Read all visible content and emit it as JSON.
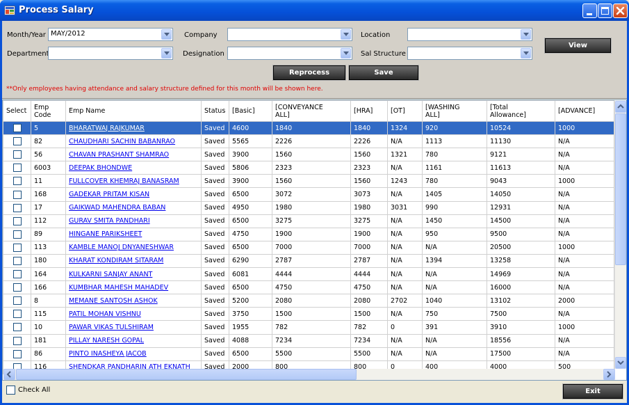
{
  "window": {
    "title": "Process Salary"
  },
  "filters": {
    "month_year": {
      "label": "Month/Year",
      "value": "MAY/2012"
    },
    "company": {
      "label": "Company",
      "value": ""
    },
    "location": {
      "label": "Location",
      "value": ""
    },
    "department": {
      "label": "Department",
      "value": ""
    },
    "designation": {
      "label": "Designation",
      "value": ""
    },
    "sal_structure": {
      "label": "Sal Structure",
      "value": ""
    }
  },
  "buttons": {
    "view": "View",
    "reprocess": "Reprocess",
    "save": "Save",
    "exit": "Exit"
  },
  "note": "**Only employees having attendance and salary structure defined for this month will be shown here.",
  "grid": {
    "columns": [
      "Select",
      "Emp Code",
      "Emp Name",
      "Status",
      "[Basic]",
      "[CONVEYANCE ALL]",
      "[HRA]",
      "[OT]",
      "[WASHING ALL]",
      "[Total Allowance]",
      "[ADVANCE]"
    ],
    "rows": [
      {
        "code": "5",
        "name": "BHARATWAJ RAJKUMAR",
        "status": "Saved",
        "basic": "4600",
        "conv": "1840",
        "hra": "1840",
        "ot": "1324",
        "wash": "920",
        "total": "10524",
        "adv": "1000",
        "selected": true
      },
      {
        "code": "82",
        "name": "CHAUDHARI SACHIN BABANRAO",
        "status": "Saved",
        "basic": "5565",
        "conv": "2226",
        "hra": "2226",
        "ot": "N/A",
        "wash": "1113",
        "total": "11130",
        "adv": "N/A"
      },
      {
        "code": "56",
        "name": "CHAVAN PRASHANT SHAMRAO",
        "status": "Saved",
        "basic": "3900",
        "conv": "1560",
        "hra": "1560",
        "ot": "1321",
        "wash": "780",
        "total": "9121",
        "adv": "N/A"
      },
      {
        "code": "6003",
        "name": "DEEPAK BHONDWE",
        "status": "Saved",
        "basic": "5806",
        "conv": "2323",
        "hra": "2323",
        "ot": "N/A",
        "wash": "1161",
        "total": "11613",
        "adv": "N/A"
      },
      {
        "code": "11",
        "name": "FULLCOVER KHEMRAJ BANASRAM",
        "status": "Saved",
        "basic": "3900",
        "conv": "1560",
        "hra": "1560",
        "ot": "1243",
        "wash": "780",
        "total": "9043",
        "adv": "1000"
      },
      {
        "code": "168",
        "name": "GADEKAR PRITAM KISAN",
        "status": "Saved",
        "basic": "6500",
        "conv": "3072",
        "hra": "3073",
        "ot": "N/A",
        "wash": "1405",
        "total": "14050",
        "adv": "N/A"
      },
      {
        "code": "17",
        "name": "GAIKWAD MAHENDRA BABAN",
        "status": "Saved",
        "basic": "4950",
        "conv": "1980",
        "hra": "1980",
        "ot": "3031",
        "wash": "990",
        "total": "12931",
        "adv": "N/A"
      },
      {
        "code": "112",
        "name": "GURAV SMITA PANDHARI",
        "status": "Saved",
        "basic": "6500",
        "conv": "3275",
        "hra": "3275",
        "ot": "N/A",
        "wash": "1450",
        "total": "14500",
        "adv": "N/A"
      },
      {
        "code": "89",
        "name": "HINGANE PARIKSHEET",
        "status": "Saved",
        "basic": "4750",
        "conv": "1900",
        "hra": "1900",
        "ot": "N/A",
        "wash": "950",
        "total": "9500",
        "adv": "N/A"
      },
      {
        "code": "113",
        "name": "KAMBLE MANOJ DNYANESHWAR",
        "status": "Saved",
        "basic": "6500",
        "conv": "7000",
        "hra": "7000",
        "ot": "N/A",
        "wash": "N/A",
        "total": "20500",
        "adv": "1000"
      },
      {
        "code": "180",
        "name": "KHARAT KONDIRAM SITARAM",
        "status": "Saved",
        "basic": "6290",
        "conv": "2787",
        "hra": "2787",
        "ot": "N/A",
        "wash": "1394",
        "total": "13258",
        "adv": "N/A"
      },
      {
        "code": "164",
        "name": "KULKARNI SANJAY ANANT",
        "status": "Saved",
        "basic": "6081",
        "conv": "4444",
        "hra": "4444",
        "ot": "N/A",
        "wash": "N/A",
        "total": "14969",
        "adv": "N/A"
      },
      {
        "code": "166",
        "name": "KUMBHAR MAHESH MAHADEV",
        "status": "Saved",
        "basic": "6500",
        "conv": "4750",
        "hra": "4750",
        "ot": "N/A",
        "wash": "N/A",
        "total": "16000",
        "adv": "N/A"
      },
      {
        "code": "8",
        "name": "MEMANE SANTOSH ASHOK",
        "status": "Saved",
        "basic": "5200",
        "conv": "2080",
        "hra": "2080",
        "ot": "2702",
        "wash": "1040",
        "total": "13102",
        "adv": "2000"
      },
      {
        "code": "115",
        "name": "PATIL MOHAN VISHNU",
        "status": "Saved",
        "basic": "3750",
        "conv": "1500",
        "hra": "1500",
        "ot": "N/A",
        "wash": "750",
        "total": "7500",
        "adv": "N/A"
      },
      {
        "code": "10",
        "name": "PAWAR VIKAS TULSHIRAM",
        "status": "Saved",
        "basic": "1955",
        "conv": "782",
        "hra": "782",
        "ot": "0",
        "wash": "391",
        "total": "3910",
        "adv": "1000"
      },
      {
        "code": "181",
        "name": "PILLAY NARESH GOPAL",
        "status": "Saved",
        "basic": "4088",
        "conv": "7234",
        "hra": "7234",
        "ot": "N/A",
        "wash": "N/A",
        "total": "18556",
        "adv": "N/A"
      },
      {
        "code": "86",
        "name": "PINTO INASHEYA JACOB",
        "status": "Saved",
        "basic": "6500",
        "conv": "5500",
        "hra": "5500",
        "ot": "N/A",
        "wash": "N/A",
        "total": "17500",
        "adv": "N/A"
      },
      {
        "code": "116",
        "name": "SHENDKAR PANDHARIN ATH EKNATH",
        "status": "Saved",
        "basic": "2000",
        "conv": "800",
        "hra": "800",
        "ot": "0",
        "wash": "400",
        "total": "4000",
        "adv": "500"
      }
    ]
  },
  "footer": {
    "check_all": "Check All"
  }
}
